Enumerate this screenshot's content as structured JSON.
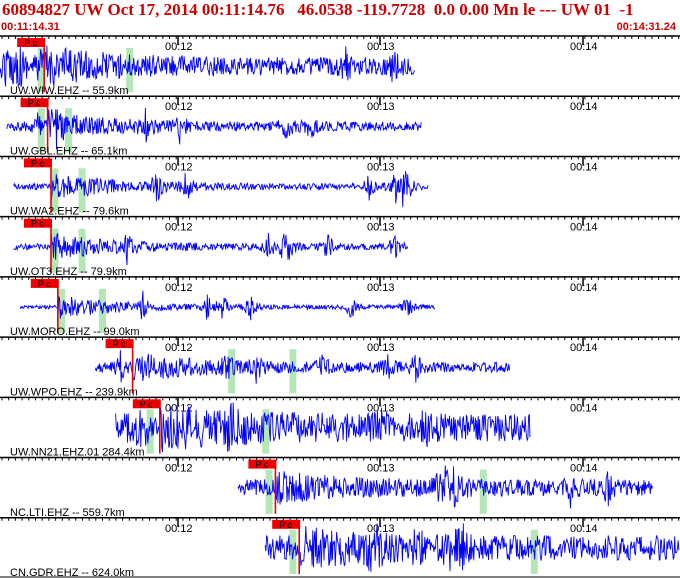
{
  "header": {
    "title": "60894827 UW Oct 17, 2014 00:11:14.76   46.0538 -119.7728  0.0 0.00 Mn le --- UW 01  -1",
    "start_time": "00:11:14.31",
    "end_time": "00:14:31.24"
  },
  "time_ticks": [
    "00:12",
    "00:13",
    "00:14"
  ],
  "colors": {
    "trace": "#0000ff",
    "pick": "#ee0000",
    "pick_label": "#000000",
    "highlight": "#b5e6b5",
    "title": "#cc0000",
    "axis": "#000000"
  },
  "traces": [
    {
      "label": "UW.WIW.EHZ -- 55.9km",
      "pick_label": "P c",
      "start": 0.0,
      "end": 0.61,
      "amp": 0.55,
      "noise": 0.35,
      "pick": 0.065,
      "greens": [
        0.06,
        0.19
      ]
    },
    {
      "label": "UW.GBL.EHZ -- 65.1km",
      "pick_label": "P c",
      "start": 0.01,
      "end": 0.62,
      "amp": 0.45,
      "noise": 0.18,
      "pick": 0.07,
      "greens": [
        0.06,
        0.1
      ]
    },
    {
      "label": "UW.WA2.EHZ -- 79.6km",
      "pick_label": "P c",
      "start": 0.02,
      "end": 0.63,
      "amp": 0.45,
      "noise": 0.12,
      "pick": 0.075,
      "greens": [
        0.08,
        0.12
      ]
    },
    {
      "label": "UW.OT3.EHZ -- 79.9km",
      "pick_label": "P c",
      "start": 0.02,
      "end": 0.6,
      "amp": 0.45,
      "noise": 0.12,
      "pick": 0.075,
      "greens": [
        0.08,
        0.12
      ]
    },
    {
      "label": "UW.MORO.EHZ -- 99.0km",
      "pick_label": "P c",
      "start": 0.03,
      "end": 0.64,
      "amp": 0.4,
      "noise": 0.08,
      "pick": 0.085,
      "greens": [
        0.09,
        0.15
      ]
    },
    {
      "label": "UW.WPO.EHZ -- 239.9km",
      "pick_label": "P c",
      "start": 0.14,
      "end": 0.75,
      "amp": 0.45,
      "noise": 0.2,
      "pick": 0.195,
      "greens": [
        0.34,
        0.43
      ]
    },
    {
      "label": "UW.NN21.EHZ.01 284.4km",
      "pick_label": "P c",
      "start": 0.17,
      "end": 0.78,
      "amp": 0.5,
      "noise": 0.55,
      "pick": 0.235,
      "greens": [
        0.22,
        0.39
      ]
    },
    {
      "label": "NC.LTI.EHZ -- 559.7km",
      "pick_label": "P c",
      "start": 0.35,
      "end": 0.96,
      "amp": 0.38,
      "noise": 0.33,
      "pick": 0.405,
      "greens": [
        0.395,
        0.71
      ]
    },
    {
      "label": "CN.GDR.EHZ -- 624.0km",
      "pick_label": "P c",
      "start": 0.39,
      "end": 1.0,
      "amp": 0.42,
      "noise": 0.5,
      "pick": 0.44,
      "greens": [
        0.43,
        0.785
      ]
    }
  ]
}
